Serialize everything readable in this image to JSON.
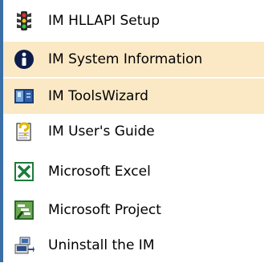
{
  "menu": {
    "items": [
      {
        "label": "IM HLLAPI Setup",
        "icon": "traffic-light-icon",
        "highlighted": false
      },
      {
        "label": "IM System Information",
        "icon": "info-icon",
        "highlighted": true
      },
      {
        "label": "IM ToolsWizard",
        "icon": "tools-wizard-icon",
        "highlighted": true
      },
      {
        "label": "IM User's Guide",
        "icon": "help-guide-icon",
        "highlighted": false
      },
      {
        "label": "Microsoft Excel",
        "icon": "excel-icon",
        "highlighted": false
      },
      {
        "label": "Microsoft Project",
        "icon": "project-icon",
        "highlighted": false
      },
      {
        "label": "Uninstall the IM",
        "icon": "uninstall-icon",
        "highlighted": false
      }
    ],
    "colors": {
      "highlight": "#fbe9c6",
      "left_bar": "#3a6ea5",
      "background": "#ffffff"
    }
  }
}
